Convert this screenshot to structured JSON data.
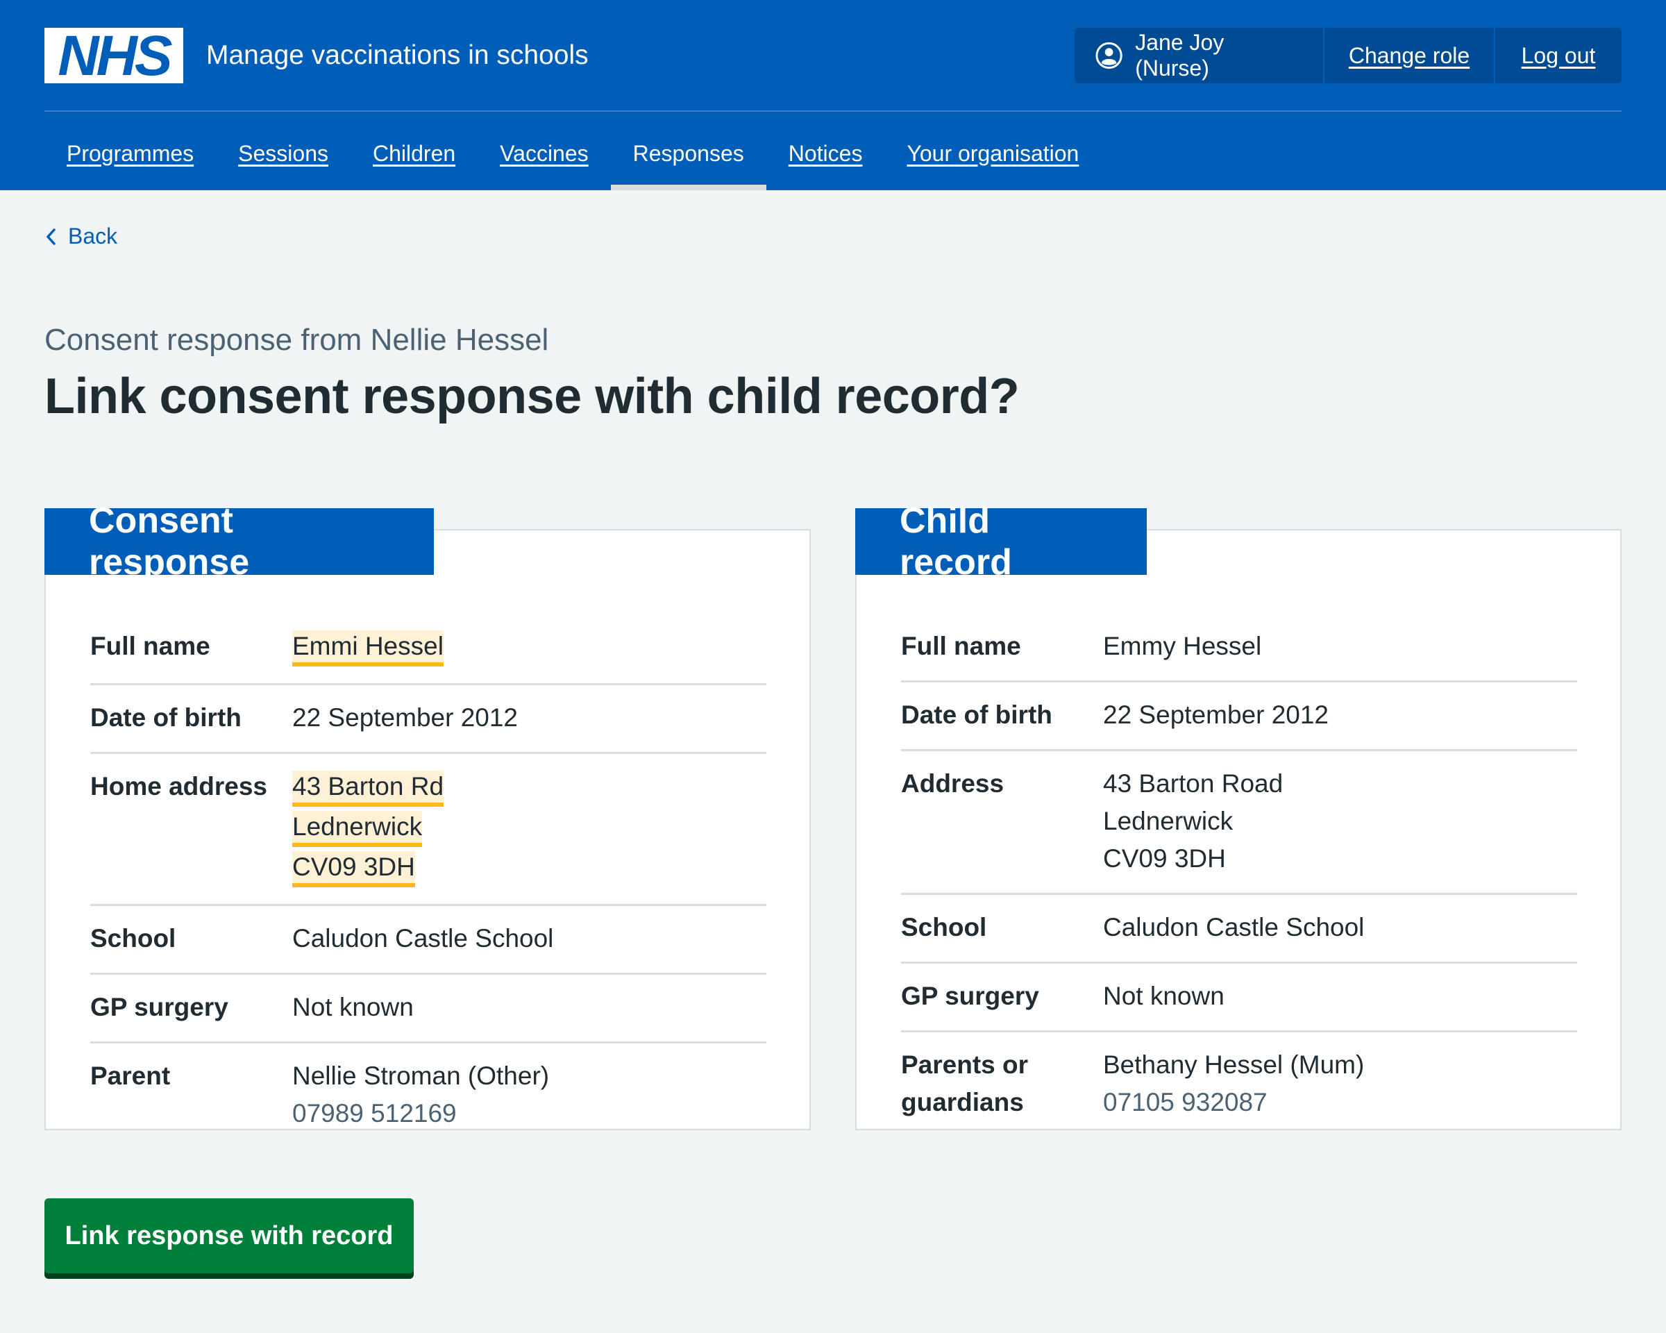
{
  "header": {
    "logo_text": "NHS",
    "service_name": "Manage vaccinations in schools",
    "account": {
      "user_label": "Jane Joy (Nurse)",
      "change_role": "Change role",
      "log_out": "Log out"
    },
    "nav": [
      {
        "label": "Programmes",
        "active": false
      },
      {
        "label": "Sessions",
        "active": false
      },
      {
        "label": "Children",
        "active": false
      },
      {
        "label": "Vaccines",
        "active": false
      },
      {
        "label": "Responses",
        "active": true
      },
      {
        "label": "Notices",
        "active": false
      },
      {
        "label": "Your organisation",
        "active": false
      }
    ]
  },
  "back_link": "Back",
  "page": {
    "caption": "Consent response from Nellie Hessel",
    "heading": "Link consent response with child record?"
  },
  "consent_response": {
    "title": "Consent response",
    "rows": {
      "full_name": {
        "label": "Full name",
        "value": "Emmi Hessel",
        "highlighted": true
      },
      "dob": {
        "label": "Date of birth",
        "value": "22 September 2012"
      },
      "address": {
        "label": "Home address",
        "lines": [
          "43 Barton Rd",
          "Lednerwick",
          "CV09 3DH"
        ],
        "highlighted": true
      },
      "school": {
        "label": "School",
        "value": "Caludon Castle School"
      },
      "gp": {
        "label": "GP surgery",
        "value": "Not known"
      },
      "parent": {
        "label": "Parent",
        "name": "Nellie Stroman (Other)",
        "phone": "07989 512169"
      }
    }
  },
  "child_record": {
    "title": "Child record",
    "rows": {
      "full_name": {
        "label": "Full name",
        "value": "Emmy Hessel"
      },
      "dob": {
        "label": "Date of birth",
        "value": "22 September 2012"
      },
      "address": {
        "label": "Address",
        "lines": [
          "43 Barton Road",
          "Lednerwick",
          "CV09 3DH"
        ]
      },
      "school": {
        "label": "School",
        "value": "Caludon Castle School"
      },
      "gp": {
        "label": "GP surgery",
        "value": "Not known"
      },
      "parent": {
        "label": "Parents or guardians",
        "name": "Bethany Hessel (Mum)",
        "phone": "07105 932087"
      }
    }
  },
  "actions": {
    "link_button": "Link response with record"
  },
  "colors": {
    "nhs_blue": "#005eb8",
    "account_bg": "#004b93",
    "highlight_bg": "#fff1d6",
    "highlight_border": "#ffb81c",
    "button_green": "#007f3b",
    "page_bg": "#f0f4f5"
  }
}
